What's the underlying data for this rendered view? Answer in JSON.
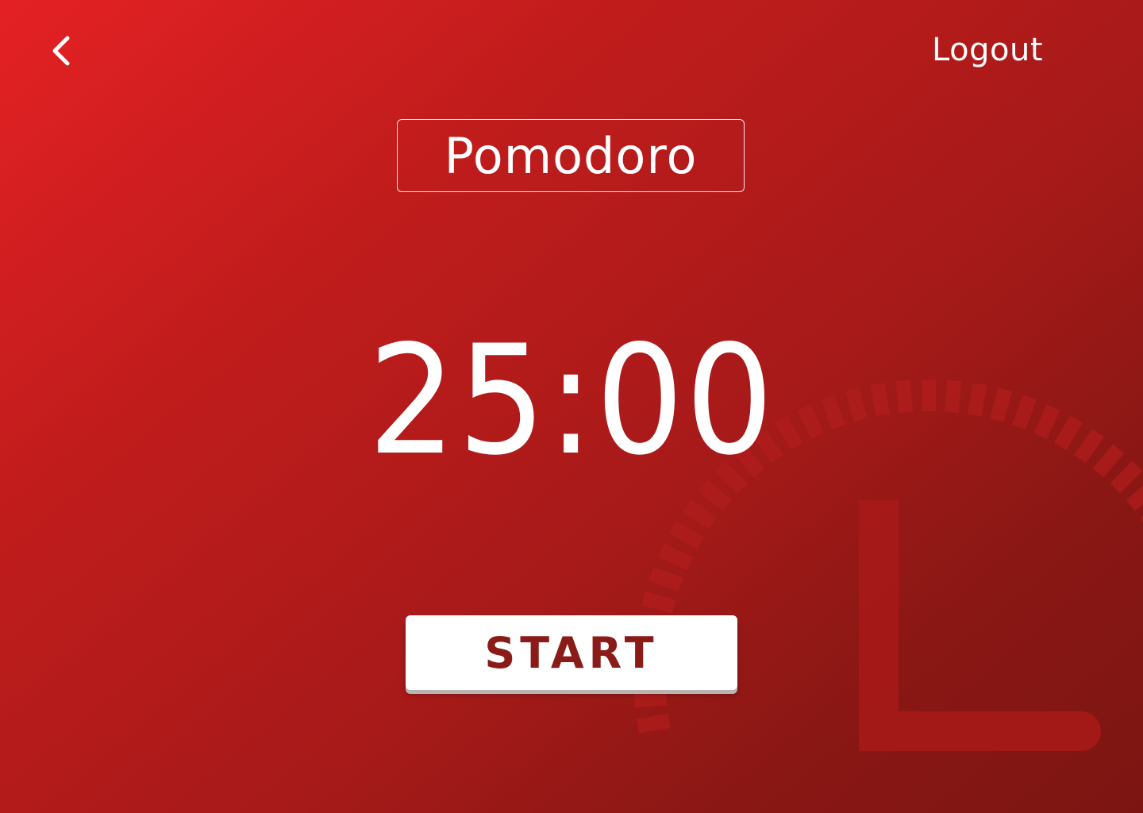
{
  "nav": {
    "back_icon": "chevron-left-icon",
    "logout_label": "Logout"
  },
  "mode": {
    "label": "Pomodoro"
  },
  "timer": {
    "display": "25:00"
  },
  "controls": {
    "start_label": "START"
  },
  "background": {
    "decoration_icon": "clock-icon"
  },
  "colors": {
    "gradient_start": "#e42124",
    "gradient_end": "#7c1512",
    "button_text": "#8a1b18",
    "text": "#ffffff"
  }
}
